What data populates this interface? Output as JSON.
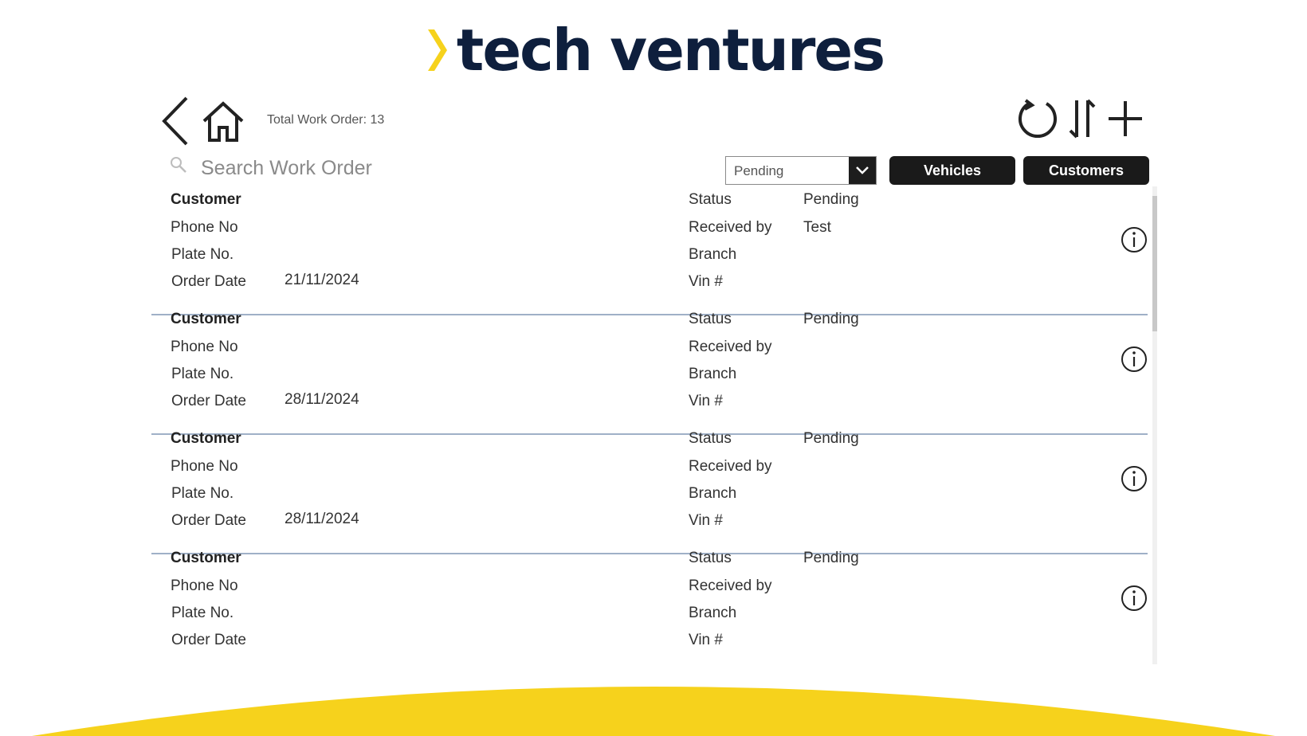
{
  "brand": {
    "name": "tech ventures",
    "accent_color": "#f6d21c",
    "text_color": "#0e1f3d"
  },
  "toolbar": {
    "back_icon": "chevron-left-icon",
    "home_icon": "home-icon",
    "total_work_order": "Total Work Order: 13",
    "refresh_icon": "refresh-icon",
    "sort_icon": "sort-icon",
    "add_icon": "plus-icon"
  },
  "search": {
    "placeholder": "Search Work Order",
    "value": ""
  },
  "filter": {
    "selected": "Pending"
  },
  "buttons": {
    "vehicles": "Vehicles",
    "customers": "Customers"
  },
  "labels": {
    "customer": "Customer",
    "phone": "Phone No",
    "plate": "Plate No.",
    "order_date": "Order Date",
    "status": "Status",
    "received_by": "Received by",
    "branch": "Branch",
    "vin": "Vin #"
  },
  "orders": [
    {
      "order_date": "21/11/2024",
      "status": "Pending",
      "received_by": "Test"
    },
    {
      "order_date": "28/11/2024",
      "status": "Pending",
      "received_by": ""
    },
    {
      "order_date": "28/11/2024",
      "status": "Pending",
      "received_by": ""
    },
    {
      "order_date": "",
      "status": "Pending",
      "received_by": ""
    }
  ]
}
